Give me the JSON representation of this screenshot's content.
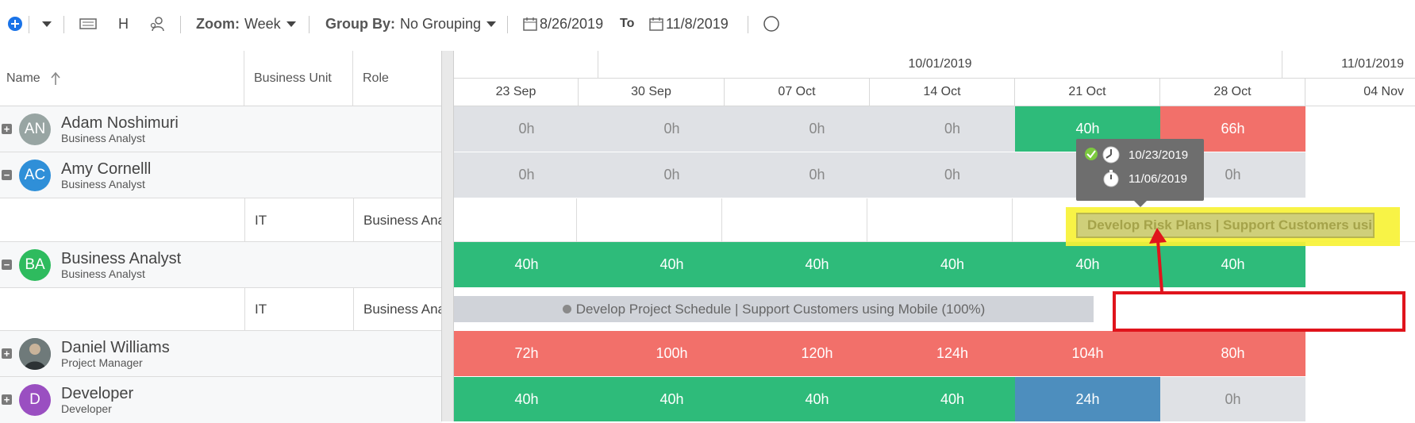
{
  "toolbar": {
    "add_icon": "plus-circle-icon",
    "zoom_label": "Zoom:",
    "zoom_value": "Week",
    "groupby_label": "Group By:",
    "groupby_value": "No Grouping",
    "h_label": "H",
    "date_from": "8/26/2019",
    "to_label": "To",
    "date_to": "11/8/2019"
  },
  "columns": {
    "name": "Name",
    "business_unit": "Business Unit",
    "role": "Role"
  },
  "timeline": {
    "months": [
      "10/01/2019",
      "11/01/2019"
    ],
    "weeks": [
      "23 Sep",
      "30 Sep",
      "07 Oct",
      "14 Oct",
      "21 Oct",
      "28 Oct",
      "04 Nov"
    ]
  },
  "rows": [
    {
      "initials": "AN",
      "name": "Adam Noshimuri",
      "role": "Business Analyst",
      "color": "#98a5a3",
      "expand": "+",
      "hours": [
        "0h",
        "0h",
        "0h",
        "0h",
        "40h",
        "66h"
      ]
    },
    {
      "initials": "AC",
      "name": "Amy Cornelll",
      "role": "Business Analyst",
      "color": "#2f8fd8",
      "expand": "−",
      "hours": [
        "0h",
        "0h",
        "0h",
        "0h",
        "",
        "0h"
      ]
    },
    {
      "initials": "BA",
      "name": "Business Analyst",
      "role": "Business Analyst",
      "color": "#2ebb5e",
      "expand": "−",
      "hours": [
        "40h",
        "40h",
        "40h",
        "40h",
        "40h",
        "40h"
      ]
    },
    {
      "initials": "",
      "name": "Daniel Williams",
      "role": "Project Manager",
      "color": "#4c5a5e",
      "expand": "+",
      "hours": [
        "72h",
        "100h",
        "120h",
        "124h",
        "104h",
        "80h"
      ]
    },
    {
      "initials": "D",
      "name": "Developer",
      "role": "Developer",
      "color": "#9a4fc1",
      "expand": "+",
      "hours": [
        "40h",
        "40h",
        "40h",
        "40h",
        "24h",
        "0h"
      ]
    }
  ],
  "subrows": [
    {
      "business_unit": "IT",
      "role": "Business Ana"
    },
    {
      "business_unit": "IT",
      "role": "Business Ana"
    }
  ],
  "tasks": {
    "risk": "Develop Risk Plans | Support Customers usir",
    "schedule": "Develop Project Schedule | Support Customers using Mobile (100%)"
  },
  "tooltip": {
    "start": "10/23/2019",
    "end": "11/06/2019"
  },
  "colors": {
    "over": "#f2706a",
    "full": "#2ebb7a",
    "under": "#4d8ebe",
    "empty": "#dfe1e5",
    "highlight": "#f7f236",
    "annotation": "#e0141c"
  }
}
